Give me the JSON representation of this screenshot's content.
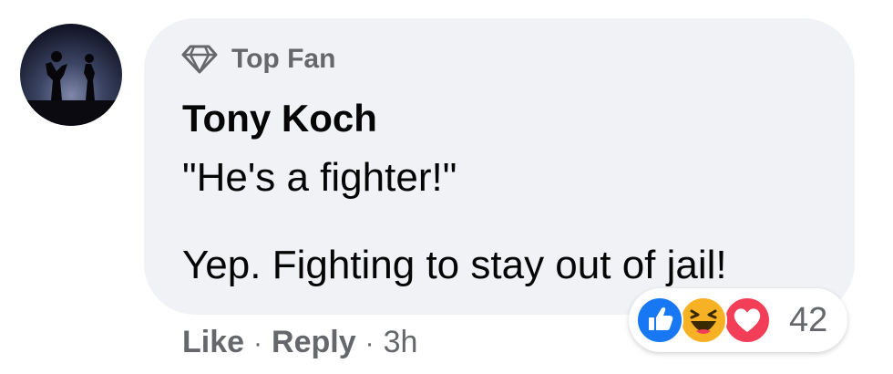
{
  "comment": {
    "badge_label": "Top Fan",
    "badge_icon": "diamond-icon",
    "author": "Tony Koch",
    "text_line1": "\"He's a fighter!\"",
    "text_line2": "Yep. Fighting to stay out of jail!",
    "reactions": {
      "icons": [
        "like-icon",
        "haha-icon",
        "love-icon"
      ],
      "count": "42"
    },
    "actions": {
      "like": "Like",
      "separator": "·",
      "reply": "Reply",
      "time": "3h"
    }
  },
  "colors": {
    "bubble_bg": "#f0f2f5",
    "secondary_text": "#65676b",
    "primary_text": "#050505",
    "like_blue": "#1877f2",
    "haha_yellow": "#f7b125",
    "love_red": "#f33e58"
  }
}
